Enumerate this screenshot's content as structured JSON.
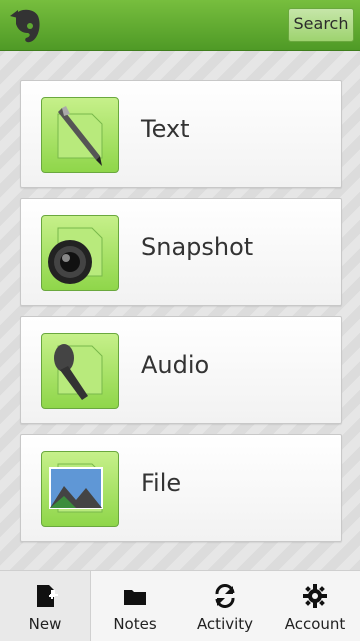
{
  "header": {
    "search_label": "Search"
  },
  "items": [
    {
      "label": "Text",
      "icon": "pen-icon"
    },
    {
      "label": "Snapshot",
      "icon": "camera-icon"
    },
    {
      "label": "Audio",
      "icon": "microphone-icon"
    },
    {
      "label": "File",
      "icon": "image-file-icon"
    }
  ],
  "tabs": [
    {
      "label": "New",
      "icon": "new-note-icon",
      "active": true
    },
    {
      "label": "Notes",
      "icon": "folder-icon"
    },
    {
      "label": "Activity",
      "icon": "sync-icon"
    },
    {
      "label": "Account",
      "icon": "gear-icon"
    }
  ],
  "colors": {
    "brand_green": "#5fa832",
    "icon_green": "#8fd64a"
  }
}
